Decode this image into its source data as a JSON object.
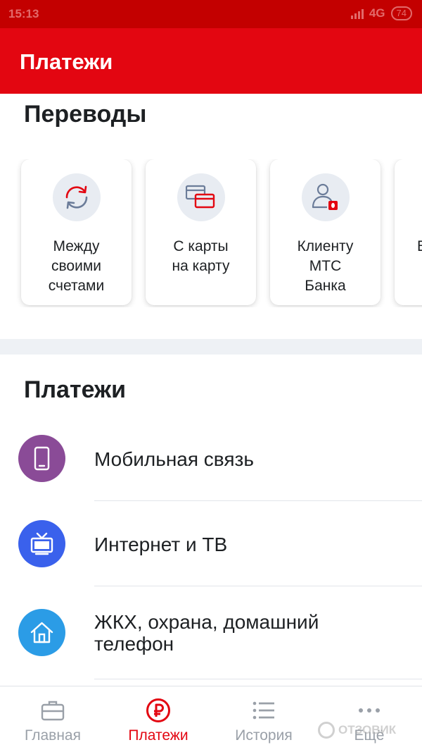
{
  "status_bar": {
    "time": "15:13",
    "network": "4G",
    "battery": "74"
  },
  "app_bar": {
    "title": "Платежи"
  },
  "transfers": {
    "title": "Переводы",
    "cards": [
      {
        "label_lines": [
          "Между",
          "своими",
          "счетами"
        ],
        "icon": "refresh-arrows-icon"
      },
      {
        "label_lines": [
          "С карты",
          "на карту"
        ],
        "icon": "cards-icon"
      },
      {
        "label_lines": [
          "Клиенту",
          "МТС",
          "Банка"
        ],
        "icon": "person-mts-icon"
      },
      {
        "label_lines": [
          "В"
        ],
        "icon": "partial-card"
      }
    ]
  },
  "payments": {
    "title": "Платежи",
    "items": [
      {
        "label_lines": [
          "Мобильная связь"
        ],
        "icon": "mobile-phone-icon",
        "color": "#8a4b97"
      },
      {
        "label_lines": [
          "Интернет и ТВ"
        ],
        "icon": "tv-icon",
        "color": "#3a61ec"
      },
      {
        "label_lines": [
          "ЖКХ, охрана, домашний",
          "телефон"
        ],
        "icon": "house-icon",
        "color": "#2b9ce6"
      }
    ]
  },
  "bottom_nav": {
    "items": [
      {
        "label": "Главная",
        "icon": "briefcase-icon",
        "active": false
      },
      {
        "label": "Платежи",
        "icon": "ruble-icon",
        "active": true
      },
      {
        "label": "История",
        "icon": "list-icon",
        "active": false
      },
      {
        "label": "Ещё",
        "icon": "more-dots-icon",
        "active": false
      }
    ]
  },
  "watermark": "ОТЗОВИК",
  "colors": {
    "brand_red": "#e30611",
    "status_red": "#c30000",
    "inactive_gray": "#9aa0a8",
    "icon_bg": "#e8ecf2"
  }
}
